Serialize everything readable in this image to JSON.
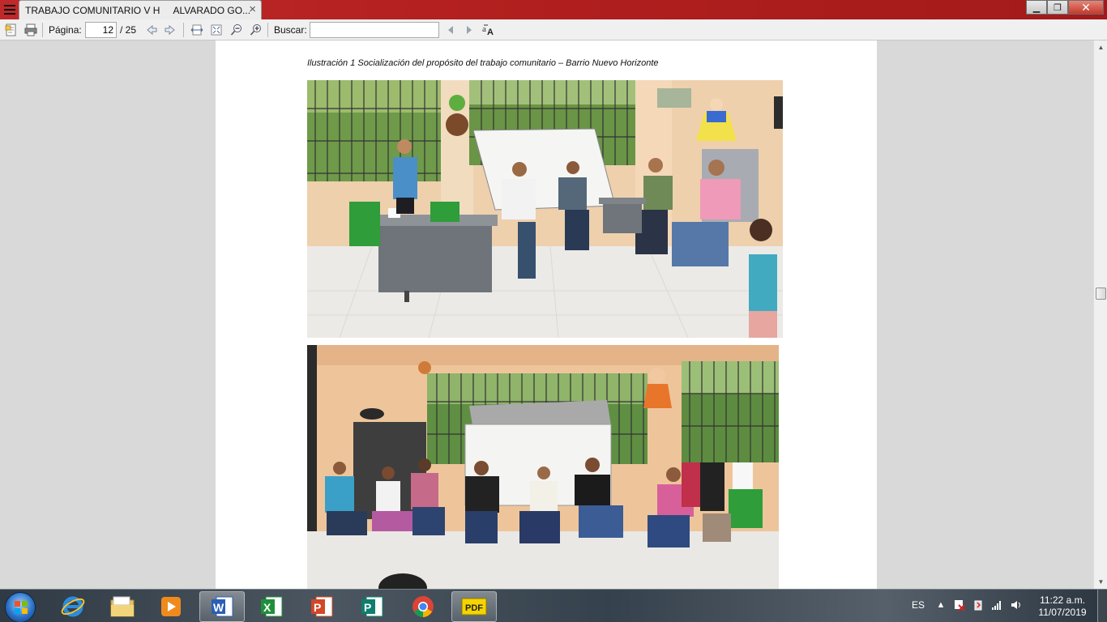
{
  "window": {
    "tab_title": "TRABAJO COMUNITARIO V H     ALVARADO GO...",
    "tab_close": "×",
    "minimize": "▁",
    "maximize": "❐",
    "close": "✕"
  },
  "toolbar": {
    "page_label": "Página:",
    "page_current": "12",
    "page_total": "/ 25",
    "search_label": "Buscar:",
    "search_value": ""
  },
  "document": {
    "caption": "Ilustración 1 Socialización del propósito del trabajo comunitario – Barrio Nuevo Horizonte"
  },
  "taskbar": {
    "items": [
      {
        "name": "internet-explorer",
        "color": "#2b8de0"
      },
      {
        "name": "file-explorer",
        "color": "#e8c35a"
      },
      {
        "name": "media-player",
        "color": "#f08a1c"
      },
      {
        "name": "word",
        "color": "#2b5fb4"
      },
      {
        "name": "excel",
        "color": "#1f8f3a"
      },
      {
        "name": "powerpoint",
        "color": "#d24726"
      },
      {
        "name": "publisher",
        "color": "#0e7f6e"
      },
      {
        "name": "chrome",
        "color": "#db4437"
      },
      {
        "name": "pdf-reader",
        "color": "#f5d400"
      }
    ],
    "language": "ES",
    "time": "11:22 a.m.",
    "date": "11/07/2019"
  }
}
